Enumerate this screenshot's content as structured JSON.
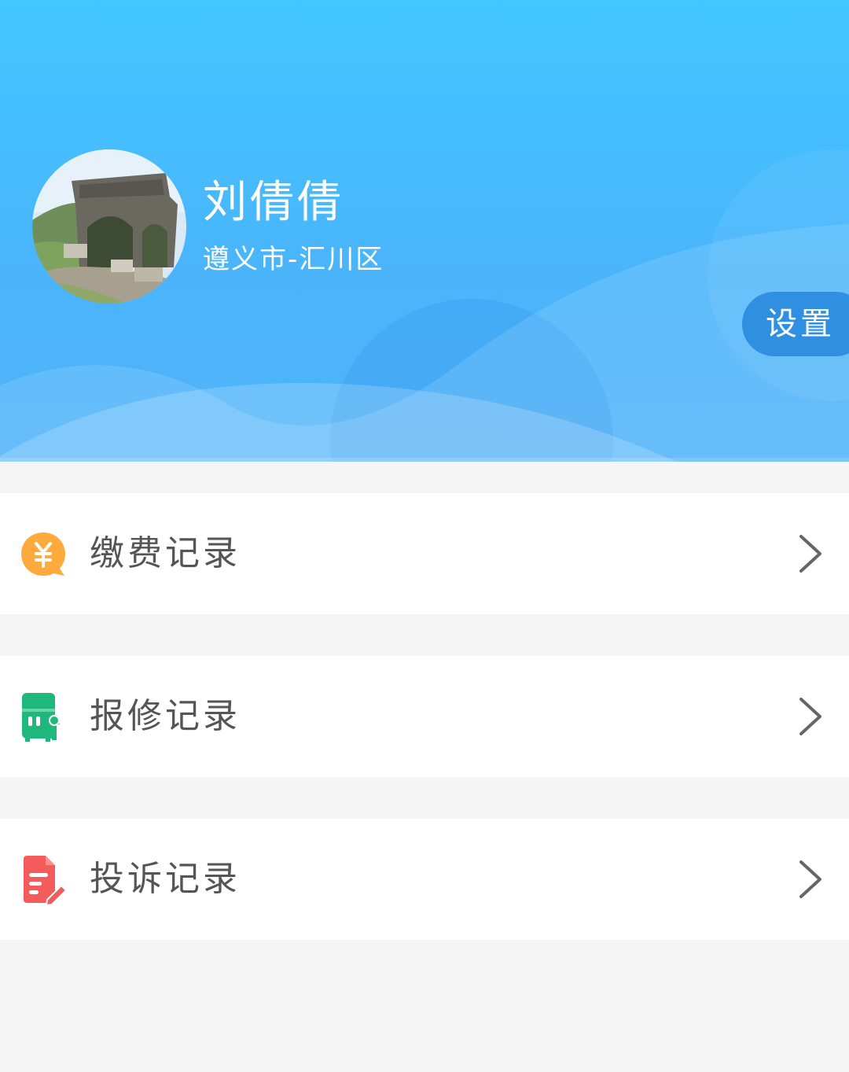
{
  "profile": {
    "name": "刘倩倩",
    "location": "遵义市-汇川区",
    "avatar_icon": "avatar-photo"
  },
  "header": {
    "settings_label": "设置"
  },
  "menu": {
    "items": [
      {
        "label": "缴费记录",
        "icon": "yuan-coin-icon",
        "color": "#ffaa3c"
      },
      {
        "label": "报修记录",
        "icon": "repair-icon",
        "color": "#1fb87c"
      },
      {
        "label": "投诉记录",
        "icon": "complaint-icon",
        "color": "#f45b5b"
      }
    ]
  },
  "colors": {
    "header_top": "#42c7ff",
    "header_bottom": "#52b4f9",
    "settings_button": "#2f8fe0",
    "page_background": "#f5f5f5",
    "menu_text": "#555555"
  }
}
